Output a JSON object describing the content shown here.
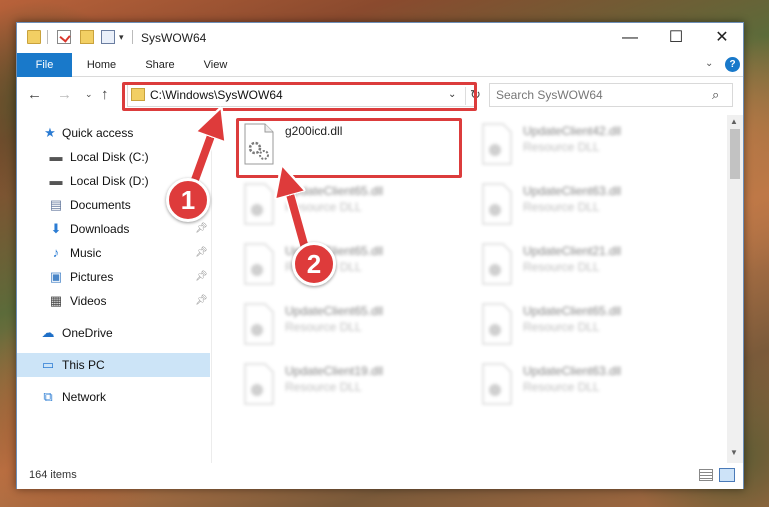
{
  "window": {
    "title": "SysWOW64",
    "controls": {
      "minimize": "—",
      "maximize": "☐",
      "close": "✕"
    }
  },
  "ribbon": {
    "tabs": [
      "File",
      "Home",
      "Share",
      "View"
    ],
    "help": "?"
  },
  "navigation": {
    "back": "←",
    "forward": "→",
    "recent": "⌄",
    "up": "↑",
    "address_path": "C:\\Windows\\SysWOW64",
    "refresh": "↻",
    "search_placeholder": "Search SysWOW64"
  },
  "sidebar": {
    "items": [
      {
        "label": "Quick access",
        "icon": "star-icon",
        "pinned": false
      },
      {
        "label": "Local Disk (C:)",
        "icon": "drive-icon",
        "pinned": false
      },
      {
        "label": "Local Disk (D:)",
        "icon": "drive-icon",
        "pinned": false
      },
      {
        "label": "Documents",
        "icon": "documents-icon",
        "pinned": true
      },
      {
        "label": "Downloads",
        "icon": "download-icon",
        "pinned": true
      },
      {
        "label": "Music",
        "icon": "music-icon",
        "pinned": true
      },
      {
        "label": "Pictures",
        "icon": "pictures-icon",
        "pinned": true
      },
      {
        "label": "Videos",
        "icon": "videos-icon",
        "pinned": true
      },
      {
        "label": "OneDrive",
        "icon": "cloud-icon",
        "pinned": false
      },
      {
        "label": "This PC",
        "icon": "computer-icon",
        "pinned": false,
        "selected": true
      },
      {
        "label": "Network",
        "icon": "network-icon",
        "pinned": false
      }
    ]
  },
  "files": [
    {
      "name": "g200icd.dll",
      "type": "",
      "highlighted": true
    },
    {
      "name": "UpdateClient42.dll",
      "type": "Resource DLL"
    },
    {
      "name": "UpdateClient65.dll",
      "type": "Resource DLL"
    },
    {
      "name": "UpdateClient63.dll",
      "type": "Resource DLL"
    },
    {
      "name": "UpdateClient65.dll",
      "type": "Resource DLL"
    },
    {
      "name": "UpdateClient21.dll",
      "type": "Resource DLL"
    },
    {
      "name": "UpdateClient65.dll",
      "type": "Resource DLL"
    },
    {
      "name": "UpdateClient65.dll",
      "type": "Resource DLL"
    },
    {
      "name": "UpdateClient19.dll",
      "type": "Resource DLL"
    },
    {
      "name": "UpdateClient63.dll",
      "type": "Resource DLL"
    }
  ],
  "status": {
    "item_count": "164 items"
  },
  "callouts": [
    "1",
    "2"
  ],
  "colors": {
    "accent": "#1979ca",
    "highlight": "#dc3c3c",
    "selected": "#cce4f7"
  }
}
